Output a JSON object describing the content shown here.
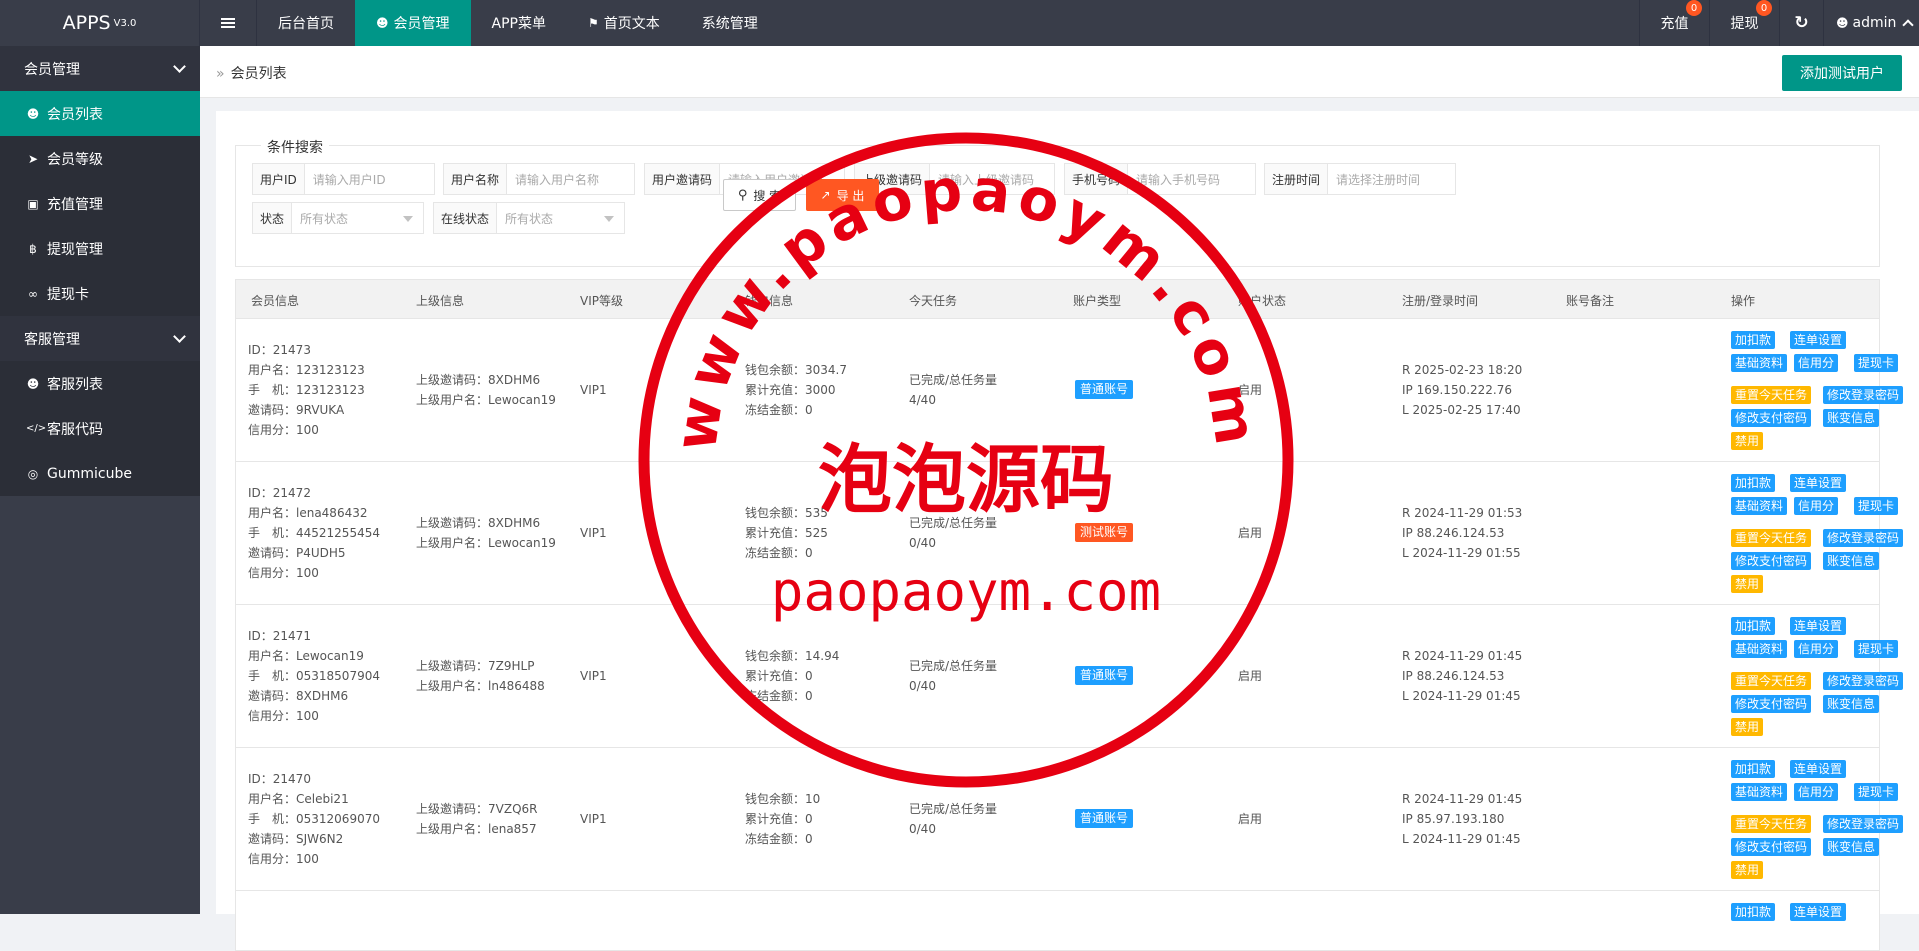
{
  "app": {
    "name": "APPS",
    "version": "V3.0"
  },
  "topnav": [
    {
      "label": "后台首页",
      "active": false
    },
    {
      "label": "会员管理",
      "active": true
    },
    {
      "label": "APP菜单",
      "active": false
    },
    {
      "label": "首页文本",
      "active": false
    },
    {
      "label": "系统管理",
      "active": false
    }
  ],
  "topright": {
    "recharge_label": "充值",
    "recharge_count": "0",
    "withdraw_label": "提现",
    "withdraw_count": "0",
    "user_label": "admin"
  },
  "sidebar": {
    "group1": "会员管理",
    "items1": [
      "会员列表",
      "会员等级",
      "充值管理",
      "提现管理",
      "提现卡"
    ],
    "group2": "客服管理",
    "items2": [
      "客服列表",
      "客服代码",
      "Gummicube"
    ]
  },
  "breadcrumb": "会员列表",
  "add_button": "添加测试用户",
  "search": {
    "legend": "条件搜索",
    "fields": [
      {
        "label": "用户ID",
        "placeholder": "请输入用户ID"
      },
      {
        "label": "用户名称",
        "placeholder": "请输入用户名称"
      },
      {
        "label": "用户邀请码",
        "placeholder": "请输入用户邀请码"
      },
      {
        "label": "上级邀请码",
        "placeholder": "请输入上级邀请码"
      },
      {
        "label": "手机号码",
        "placeholder": "请输入手机号码"
      },
      {
        "label": "注册时间",
        "placeholder": "请选择注册时间"
      }
    ],
    "status_label": "状态",
    "status_value": "所有状态",
    "online_label": "在线状态",
    "online_value": "所有状态",
    "search_btn": "搜 索",
    "export_btn": "导 出"
  },
  "table": {
    "headers": [
      "会员信息",
      "上级信息",
      "VIP等级",
      "钱包信息",
      "今天任务",
      "账户类型",
      "账户状态",
      "注册/登录时间",
      "账号备注",
      "操作"
    ],
    "rows": [
      {
        "id": "ID：21473",
        "username": "用户名：123123123",
        "phone": "手　机：123123123",
        "invite": "邀请码：9RVUKA",
        "credit": "信用分：100",
        "parent_code": "上级邀请码：8XDHM6",
        "parent_name": "上级用户名：Lewocan19",
        "vip": "VIP1",
        "balance": "钱包余额：3034.7",
        "total_recharge": "累计充值：3000",
        "frozen": "冻结金额：0",
        "task_label": "已完成/总任务量",
        "task_value": "4/40",
        "account_type": "普通账号",
        "account_kind": "normal",
        "status": "启用",
        "reg": "R 2025-02-23 18:20",
        "ip": "IP 169.150.222.76",
        "login": "L 2025-02-25 17:40"
      },
      {
        "id": "ID：21472",
        "username": "用户名：lena486432",
        "phone": "手　机：44521255454",
        "invite": "邀请码：P4UDH5",
        "credit": "信用分：100",
        "parent_code": "上级邀请码：8XDHM6",
        "parent_name": "上级用户名：Lewocan19",
        "vip": "VIP1",
        "balance": "钱包余额：535",
        "total_recharge": "累计充值：525",
        "frozen": "冻结金额：0",
        "task_label": "已完成/总任务量",
        "task_value": "0/40",
        "account_type": "测试账号",
        "account_kind": "test",
        "status": "启用",
        "reg": "R 2024-11-29 01:53",
        "ip": "IP 88.246.124.53",
        "login": "L 2024-11-29 01:55"
      },
      {
        "id": "ID：21471",
        "username": "用户名：Lewocan19",
        "phone": "手　机：05318507904",
        "invite": "邀请码：8XDHM6",
        "credit": "信用分：100",
        "parent_code": "上级邀请码：7Z9HLP",
        "parent_name": "上级用户名：ln486488",
        "vip": "VIP1",
        "balance": "钱包余额：14.94",
        "total_recharge": "累计充值：0",
        "frozen": "冻结金额：0",
        "task_label": "已完成/总任务量",
        "task_value": "0/40",
        "account_type": "普通账号",
        "account_kind": "normal",
        "status": "启用",
        "reg": "R 2024-11-29 01:45",
        "ip": "IP 88.246.124.53",
        "login": "L 2024-11-29 01:45"
      },
      {
        "id": "ID：21470",
        "username": "用户名：Celebi21",
        "phone": "手　机：05312069070",
        "invite": "邀请码：SJW6N2",
        "credit": "信用分：100",
        "parent_code": "上级邀请码：7VZQ6R",
        "parent_name": "上级用户名：lena857",
        "vip": "VIP1",
        "balance": "钱包余额：10",
        "total_recharge": "累计充值：0",
        "frozen": "冻结金额：0",
        "task_label": "已完成/总任务量",
        "task_value": "0/40",
        "account_type": "普通账号",
        "account_kind": "normal",
        "status": "启用",
        "reg": "R 2024-11-29 01:45",
        "ip": "IP 85.97.193.180",
        "login": "L 2024-11-29 01:45"
      }
    ],
    "ops": [
      "加扣款",
      "连单设置",
      "基础资料",
      "信用分",
      "提现卡",
      "重置今天任务",
      "修改登录密码",
      "修改支付密码",
      "账变信息",
      "禁用"
    ]
  },
  "watermark": {
    "url_arc": "www.paopaoym.com",
    "cn": "泡泡源码",
    "url": "paopaoym.com"
  }
}
